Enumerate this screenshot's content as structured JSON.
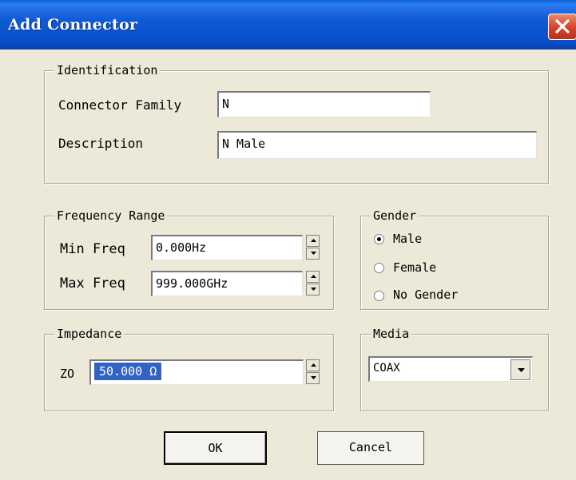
{
  "window": {
    "title": "Add Connector"
  },
  "identification": {
    "legend": "Identification",
    "family_label": "Connector Family",
    "family_value": "N",
    "description_label": "Description",
    "description_value": "N Male"
  },
  "frequency": {
    "legend": "Frequency Range",
    "min_label": "Min Freq",
    "min_value": "0.000Hz",
    "max_label": "Max Freq",
    "max_value": "999.000GHz"
  },
  "gender": {
    "legend": "Gender",
    "options": [
      {
        "label": "Male",
        "selected": true
      },
      {
        "label": "Female",
        "selected": false
      },
      {
        "label": "No Gender",
        "selected": false
      }
    ]
  },
  "impedance": {
    "legend": "Impedance",
    "z_label": "ZO",
    "z_value": "50.000 Ω"
  },
  "media": {
    "legend": "Media",
    "selected": "COAX"
  },
  "buttons": {
    "ok": "OK",
    "cancel": "Cancel"
  }
}
